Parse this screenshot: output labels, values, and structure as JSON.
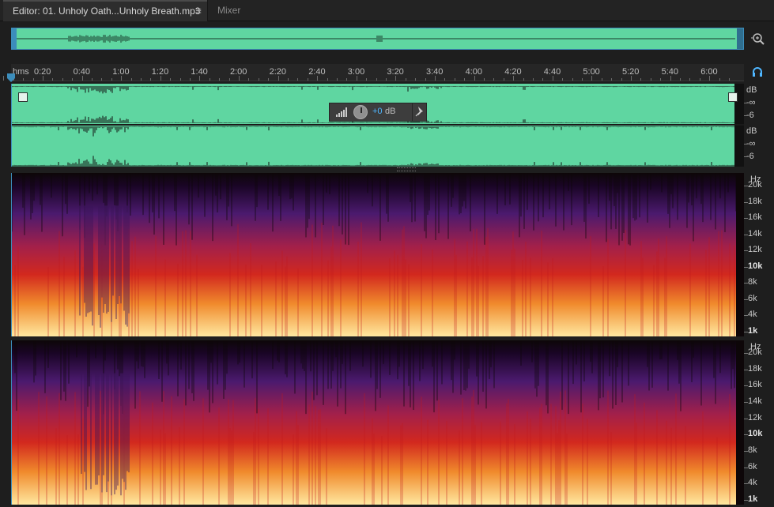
{
  "tabs": {
    "editor": "Editor: 01. Unholy Oath...Unholy Breath.mp3",
    "menu_glyph": "≡",
    "mixer": "Mixer"
  },
  "ruler": {
    "unit_label": "hms",
    "time_labels": [
      "0:20",
      "0:40",
      "1:00",
      "1:20",
      "1:40",
      "2:00",
      "2:20",
      "2:40",
      "3:00",
      "3:20",
      "3:40",
      "4:00",
      "4:20",
      "4:40",
      "5:00",
      "5:20",
      "5:40",
      "6:00"
    ]
  },
  "hud": {
    "value": "+0",
    "unit": "dB"
  },
  "db_scale": {
    "channel_1": [
      "dB",
      "-∞",
      "-6"
    ],
    "channel_2": [
      "dB",
      "-∞",
      "-6"
    ]
  },
  "hz_scale": {
    "unit": "Hz",
    "labels": [
      "20k",
      "18k",
      "16k",
      "14k",
      "12k",
      "10k",
      "8k",
      "6k",
      "4k",
      "1k"
    ],
    "bold": [
      "10k",
      "1k"
    ]
  },
  "icons": {
    "zoom": "zoom-icon",
    "monitor": "headphones-icon",
    "playhead": "playhead-marker-icon",
    "pin": "pin-icon",
    "hud_level": "level-bars-icon",
    "hud_knob": "gain-knob-icon"
  },
  "colors": {
    "waveform": "#5fd6a1",
    "accent": "#3c8dbb",
    "hud_value": "#4fb6ff",
    "spectral_low": "#1a0526",
    "spectral_mid": "#d2281e",
    "spectral_high": "#ffe8a0"
  }
}
